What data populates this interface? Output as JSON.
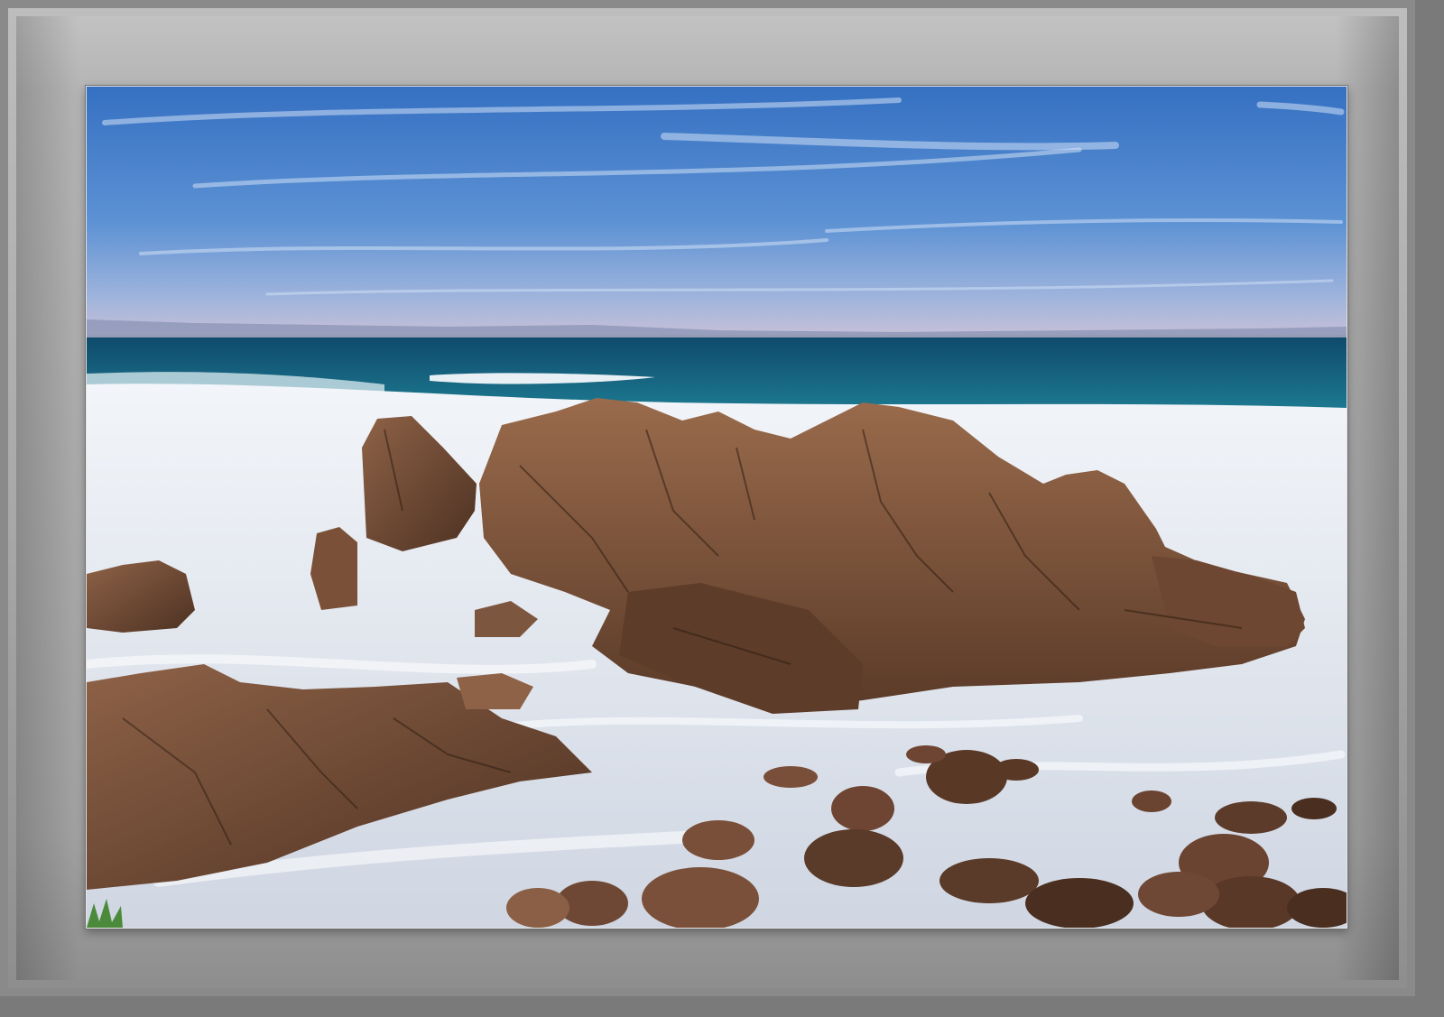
{
  "frame": {
    "outer_color": "#8a8a8a",
    "mat_light": "#c2c2c2",
    "mat_dark": "#8f8f8f"
  },
  "photo": {
    "sky_top": "#3b74c2",
    "sky_horizon": "#b9b7d6",
    "ocean": "#15587a",
    "foam": "#e9eef4",
    "rock": "#7a4f34",
    "rock_dark": "#3e271b"
  }
}
